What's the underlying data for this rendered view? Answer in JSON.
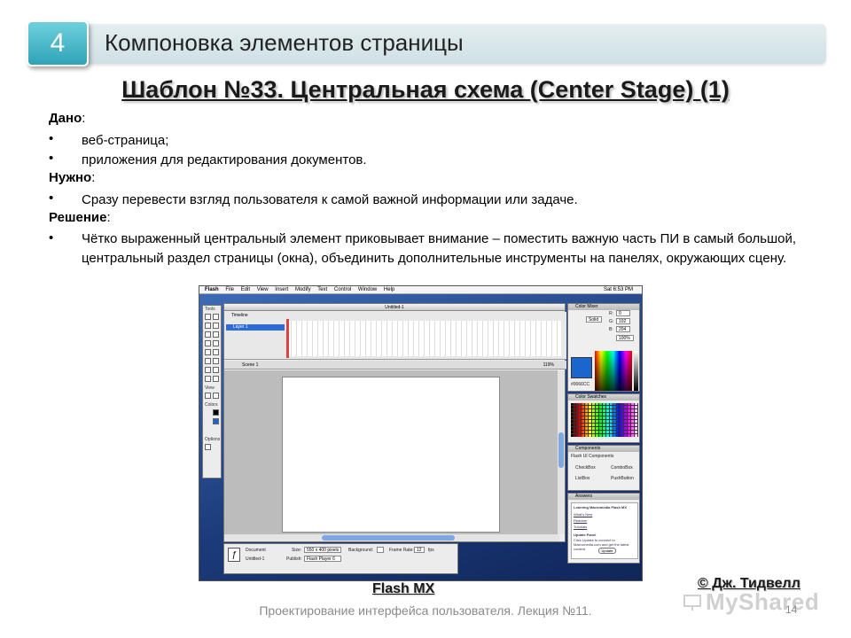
{
  "header": {
    "slide_number": "4",
    "section_title": "Компоновка элементов страницы"
  },
  "subtitle": "Шаблон №33. Центральная схема (Center Stage) (1)",
  "content": {
    "given_label": "Дано",
    "given_items": [
      "веб-страница;",
      "приложения для редактирования документов."
    ],
    "need_label": "Нужно",
    "need_items": [
      "Сразу перевести взгляд пользователя к самой важной информации или задаче."
    ],
    "solution_label": "Решение",
    "solution_items": [
      "Чётко выраженный центральный элемент приковывает внимание – поместить важную часть ПИ в самый большой, центральный  раздел страницы (окна), объединить дополнительные инструменты на панелях, окружающих сцену."
    ],
    "colon": ":",
    "bullet": "•"
  },
  "screenshot": {
    "menu": [
      "Flash",
      "File",
      "Edit",
      "View",
      "Insert",
      "Modify",
      "Text",
      "Control",
      "Window",
      "Help"
    ],
    "clock": "Sat 6:53 PM",
    "doc_title": "Untitled-1",
    "timeline_label": "Timeline",
    "layer_name": "Layer 1",
    "scene_label": "Scene 1",
    "zoom": "119%",
    "tools_title": "Tools",
    "view_label": "View",
    "colors_label": "Colors",
    "options_label": "Options",
    "color_mixer_title": "Color Mixer",
    "solid_label": "Solid",
    "rgb": {
      "r": "0",
      "g": "102",
      "b": "204"
    },
    "alpha": "100%",
    "hex": "#0066CC",
    "swatches_title": "Color Swatches",
    "components_title": "Components",
    "components_set": "Flash UI Components",
    "components": [
      "CheckBox",
      "ComboBox",
      "ListBox",
      "PushButton"
    ],
    "answers_title": "Answers",
    "answers_heading": "Learning Macromedia Flash MX",
    "answers_links": [
      "What's New",
      "Readme",
      "Tutorials"
    ],
    "update_panel_title": "Update Panel",
    "update_text": "Click Update to connect to Macromedia.com and get the latest content",
    "update_button": "Update",
    "props": {
      "document_label": "Document",
      "doc_name": "Untitled-1",
      "size_label": "Size:",
      "size_value": "550 x 400 pixels",
      "publish_label": "Publish:",
      "publish_value": "Flash Player 6",
      "background_label": "Background:",
      "framerate_label": "Frame Rate:",
      "framerate_value": "12",
      "fps": "fps"
    }
  },
  "caption": "Flash MX",
  "author": "© Дж. Тидвелл",
  "footer": "Проектирование интерфейса пользователя. Лекция №11.",
  "page_number": "14",
  "watermark": "MyShared",
  "colors": {
    "accent": "#2fa3b8",
    "header_bar": "#d6e5e9"
  }
}
